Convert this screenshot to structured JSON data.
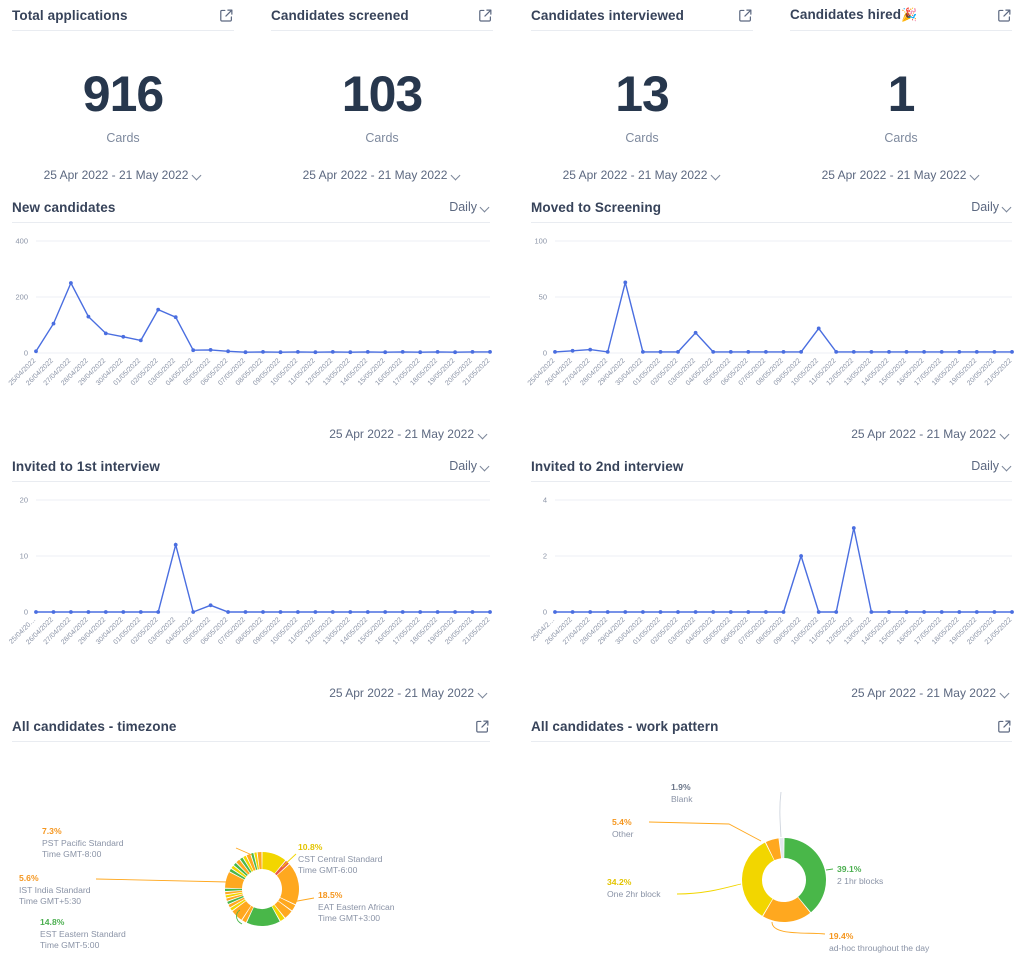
{
  "colors": {
    "accent_line": "#4a6ee0",
    "title": "#37435a",
    "value": "#27374d",
    "muted": "#7e8a9e",
    "rule": "#e9ecf1",
    "green": "#49b749",
    "yellow": "#f2d600",
    "orange": "#ffa81f",
    "orange_dark": "#f5961e",
    "red": "#eb5a46",
    "grey": "#d8dde5"
  },
  "date_range_label": "25 Apr 2022 - 21 May 2022",
  "daily_label": "Daily",
  "open_icon": "external-link-icon",
  "kpis": [
    {
      "title": "Total applications",
      "emoji": "",
      "value": "916",
      "unit": "Cards",
      "range": "25 Apr 2022 - 21 May 2022"
    },
    {
      "title": "Candidates screened",
      "emoji": "",
      "value": "103",
      "unit": "Cards",
      "range": "25 Apr 2022 - 21 May 2022"
    },
    {
      "title": "Candidates interviewed",
      "emoji": "",
      "value": "13",
      "unit": "Cards",
      "range": "25 Apr 2022 - 21 May 2022"
    },
    {
      "title": "Candidates hired",
      "emoji": "🎉",
      "value": "1",
      "unit": "Cards",
      "range": "25 Apr 2022 - 21 May 2022"
    }
  ],
  "chart_data": [
    {
      "id": "new-candidates",
      "type": "line",
      "title": "New candidates",
      "granularity": "Daily",
      "range": "25 Apr 2022 - 21 May 2022",
      "xlabel": "",
      "ylabel": "",
      "ylim": [
        0,
        400
      ],
      "yticks": [
        0,
        200,
        400
      ],
      "grid": true,
      "legend": "none",
      "categories": [
        "25/04/2022",
        "26/04/2022",
        "27/04/2022",
        "28/04/2022",
        "29/04/2022",
        "30/04/2022",
        "01/05/2022",
        "02/05/2022",
        "03/05/2022",
        "04/05/2022",
        "05/05/2022",
        "06/05/2022",
        "07/05/2022",
        "08/05/2022",
        "09/05/2022",
        "10/05/2022",
        "11/05/2022",
        "12/05/2022",
        "13/05/2022",
        "14/05/2022",
        "15/05/2022",
        "16/05/2022",
        "17/05/2022",
        "18/05/2022",
        "19/05/2022",
        "20/05/2022",
        "21/05/2022"
      ],
      "values": [
        6,
        105,
        250,
        130,
        70,
        58,
        45,
        155,
        128,
        10,
        11,
        6,
        3,
        4,
        3,
        4,
        3,
        4,
        3,
        4,
        3,
        4,
        3,
        4,
        3,
        4,
        4
      ]
    },
    {
      "id": "moved-to-screening",
      "type": "line",
      "title": "Moved to Screening",
      "granularity": "Daily",
      "range": "25 Apr 2022 - 21 May 2022",
      "xlabel": "",
      "ylabel": "",
      "ylim": [
        0,
        100
      ],
      "yticks": [
        0,
        50,
        100
      ],
      "grid": true,
      "legend": "none",
      "categories": [
        "25/04/2022",
        "26/04/2022",
        "27/04/2022",
        "28/04/2022",
        "29/04/2022",
        "30/04/2022",
        "01/05/2022",
        "02/05/2022",
        "03/05/2022",
        "04/05/2022",
        "05/05/2022",
        "06/05/2022",
        "07/05/2022",
        "08/05/2022",
        "09/05/2022",
        "10/05/2022",
        "11/05/2022",
        "12/05/2022",
        "13/05/2022",
        "14/05/2022",
        "15/05/2022",
        "16/05/2022",
        "17/05/2022",
        "18/05/2022",
        "19/05/2022",
        "20/05/2022",
        "21/05/2022"
      ],
      "values": [
        1,
        2,
        3,
        1,
        63,
        1,
        1,
        1,
        18,
        1,
        1,
        1,
        1,
        1,
        1,
        22,
        1,
        1,
        1,
        1,
        1,
        1,
        1,
        1,
        1,
        1,
        1
      ]
    },
    {
      "id": "invited-1st-interview",
      "type": "line",
      "title": "Invited to 1st interview",
      "granularity": "Daily",
      "range": "25 Apr 2022 - 21 May 2022",
      "xlabel": "",
      "ylabel": "",
      "ylim": [
        0,
        20
      ],
      "yticks": [
        0,
        10,
        20
      ],
      "grid": true,
      "legend": "none",
      "categories": [
        "25/04/20…",
        "26/04/2022",
        "27/04/2022",
        "28/04/2022",
        "29/04/2022",
        "30/04/2022",
        "01/05/2022",
        "02/05/2022",
        "03/05/2022",
        "04/05/2022",
        "05/05/2022",
        "06/05/2022",
        "07/05/2022",
        "08/05/2022",
        "09/05/2022",
        "10/05/2022",
        "11/05/2022",
        "12/05/2022",
        "13/05/2022",
        "14/05/2022",
        "15/05/2022",
        "16/05/2022",
        "17/05/2022",
        "18/05/2022",
        "19/05/2022",
        "20/05/2022",
        "21/05/2022"
      ],
      "values": [
        0,
        0,
        0,
        0,
        0,
        0,
        0,
        0,
        12,
        0,
        1.2,
        0,
        0,
        0,
        0,
        0,
        0,
        0,
        0,
        0,
        0,
        0,
        0,
        0,
        0,
        0,
        0
      ]
    },
    {
      "id": "invited-2nd-interview",
      "type": "line",
      "title": "Invited to 2nd interview",
      "granularity": "Daily",
      "range": "25 Apr 2022 - 21 May 2022",
      "xlabel": "",
      "ylabel": "",
      "ylim": [
        0,
        4
      ],
      "yticks": [
        0,
        2,
        4
      ],
      "grid": true,
      "legend": "none",
      "categories": [
        "25/04/2…",
        "26/04/2022",
        "27/04/2022",
        "28/04/2022",
        "29/04/2022",
        "30/04/2022",
        "01/05/2022",
        "02/05/2022",
        "03/05/2022",
        "04/05/2022",
        "05/05/2022",
        "06/05/2022",
        "07/05/2022",
        "08/05/2022",
        "09/05/2022",
        "10/05/2022",
        "11/05/2022",
        "12/05/2022",
        "13/05/2022",
        "14/05/2022",
        "15/05/2022",
        "16/05/2022",
        "17/05/2022",
        "18/05/2022",
        "19/05/2022",
        "20/05/2022",
        "21/05/2022"
      ],
      "values": [
        0,
        0,
        0,
        0,
        0,
        0,
        0,
        0,
        0,
        0,
        0,
        0,
        0,
        0,
        2,
        0,
        0,
        3,
        0,
        0,
        0,
        0,
        0,
        0,
        0,
        0,
        0
      ]
    },
    {
      "id": "all-candidates-timezone",
      "type": "pie",
      "title": "All candidates - timezone",
      "subtitle": "",
      "legend": "callout-labels",
      "labelled_slices": [
        {
          "pct": "10.8%",
          "label": "CST Central Standard Time GMT-6:00",
          "value": 10.8,
          "color": "#f2d600",
          "pct_color": "#e3c400",
          "side": "right"
        },
        {
          "pct": "18.5%",
          "label": "EAT Eastern African Time GMT+3:00",
          "value": 18.5,
          "color": "#ffa81f",
          "pct_color": "#f5961e",
          "side": "right"
        },
        {
          "pct": "14.8%",
          "label": "EST Eastern Standard Time GMT-5:00",
          "value": 14.8,
          "color": "#49b749",
          "pct_color": "#4caf50",
          "side": "left"
        },
        {
          "pct": "5.6%",
          "label": "IST India Standard Time GMT+5:30",
          "value": 5.6,
          "color": "#ffa81f",
          "pct_color": "#f5961e",
          "side": "left"
        },
        {
          "pct": "7.3%",
          "label": "PST Pacific Standard Time GMT-8:00",
          "value": 7.3,
          "color": "#ffa81f",
          "pct_color": "#f5961e",
          "side": "left"
        }
      ],
      "slices": [
        {
          "value": 10.8,
          "color": "#f2d600"
        },
        {
          "value": 2.1,
          "color": "#eb5a46"
        },
        {
          "value": 18.5,
          "color": "#ffa81f"
        },
        {
          "value": 3.0,
          "color": "#ffa81f"
        },
        {
          "value": 4.2,
          "color": "#ffa81f"
        },
        {
          "value": 2.4,
          "color": "#f2d600"
        },
        {
          "value": 14.8,
          "color": "#49b749"
        },
        {
          "value": 2.2,
          "color": "#ffa81f"
        },
        {
          "value": 5.6,
          "color": "#ffa81f"
        },
        {
          "value": 1.6,
          "color": "#f2d600"
        },
        {
          "value": 1.6,
          "color": "#ffa81f"
        },
        {
          "value": 1.4,
          "color": "#49b749"
        },
        {
          "value": 1.4,
          "color": "#ffa81f"
        },
        {
          "value": 1.4,
          "color": "#f2d600"
        },
        {
          "value": 1.4,
          "color": "#ffa81f"
        },
        {
          "value": 1.4,
          "color": "#49b749"
        },
        {
          "value": 7.3,
          "color": "#ffa81f"
        },
        {
          "value": 1.6,
          "color": "#49b749"
        },
        {
          "value": 1.6,
          "color": "#f2d600"
        },
        {
          "value": 1.6,
          "color": "#49b749"
        },
        {
          "value": 2.0,
          "color": "#ffa81f"
        },
        {
          "value": 1.6,
          "color": "#49b749"
        },
        {
          "value": 1.6,
          "color": "#f2d600"
        },
        {
          "value": 2.0,
          "color": "#ffa81f"
        },
        {
          "value": 1.4,
          "color": "#49b749"
        },
        {
          "value": 1.4,
          "color": "#f2d600"
        },
        {
          "value": 2.1,
          "color": "#ffa81f"
        }
      ]
    },
    {
      "id": "all-candidates-work-pattern",
      "type": "pie",
      "title": "All candidates - work pattern",
      "subtitle": "",
      "legend": "callout-labels",
      "labelled_slices": [
        {
          "pct": "39.1%",
          "label": "2 1hr blocks",
          "value": 39.1,
          "color": "#49b749",
          "pct_color": "#4caf50",
          "side": "right"
        },
        {
          "pct": "19.4%",
          "label": "ad-hoc throughout the day",
          "value": 19.4,
          "color": "#ffa81f",
          "pct_color": "#f5961e",
          "side": "right"
        },
        {
          "pct": "34.2%",
          "label": "One 2hr block",
          "value": 34.2,
          "color": "#f2d600",
          "pct_color": "#e3c400",
          "side": "left"
        },
        {
          "pct": "5.4%",
          "label": "Other",
          "value": 5.4,
          "color": "#ffa81f",
          "pct_color": "#f5961e",
          "side": "left"
        },
        {
          "pct": "1.9%",
          "label": "Blank",
          "value": 1.9,
          "color": "#e3e7ee",
          "pct_color": "#6b7689",
          "side": "left"
        }
      ],
      "slices": [
        {
          "value": 39.1,
          "color": "#49b749"
        },
        {
          "value": 19.4,
          "color": "#ffa81f"
        },
        {
          "value": 34.2,
          "color": "#f2d600"
        },
        {
          "value": 5.4,
          "color": "#ffa81f"
        },
        {
          "value": 1.9,
          "color": "#e3e7ee"
        }
      ]
    }
  ]
}
